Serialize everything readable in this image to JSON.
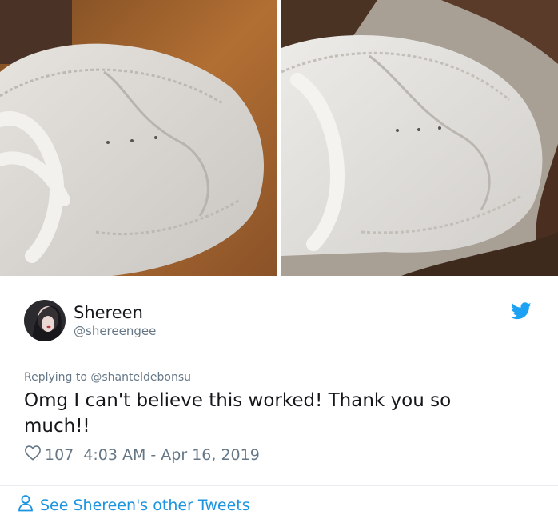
{
  "tweet": {
    "display_name": "Shereen",
    "handle": "@shereengee",
    "replying_prefix": "Replying to",
    "replying_to": "@shanteldebonsu",
    "text": "Omg I can't believe this worked! Thank you so much!!",
    "likes": "107",
    "timestamp": "4:03 AM - Apr 16, 2019",
    "see_more_label": "See Shereen's other Tweets"
  },
  "icons": {
    "brand": "twitter-bird-icon",
    "like": "heart-icon",
    "profile": "user-icon"
  },
  "colors": {
    "accent": "#1b95e0",
    "secondary_text": "#657786",
    "primary_text": "#14171a"
  }
}
